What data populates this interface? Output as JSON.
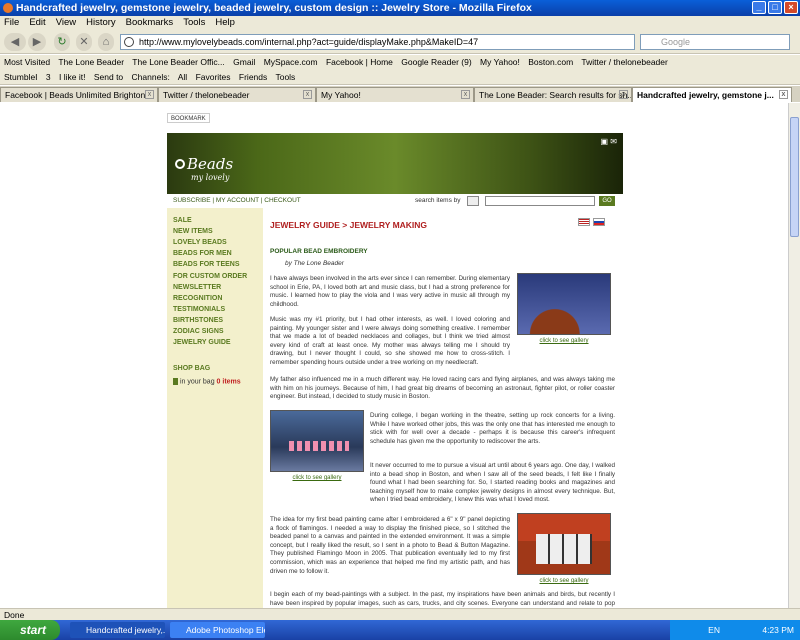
{
  "window": {
    "title": "Handcrafted jewelry, gemstone jewelry, beaded jewelry, custom design :: Jewelry Store - Mozilla Firefox"
  },
  "menu": [
    "File",
    "Edit",
    "View",
    "History",
    "Bookmarks",
    "Tools",
    "Help"
  ],
  "nav": {
    "url": "http://www.mylovelybeads.com/internal.php?act=guide/displayMake.php&MakeID=47",
    "search_placeholder": "Google"
  },
  "bookmarks": [
    "Most Visited",
    "The Lone Beader",
    "The Lone Beader Offic...",
    "Gmail",
    "MySpace.com",
    "Facebook | Home",
    "Google Reader (9)",
    "My Yahoo!",
    "Boston.com",
    "Twitter / thelonebeader"
  ],
  "toolbar2": [
    "StumbleI",
    "3",
    "I like it!",
    "Send to",
    "Channels:",
    "All",
    "Favorites",
    "Friends",
    "Tools"
  ],
  "tabs": [
    "Facebook | Beads Unlimited Brighton",
    "Twitter / thelonebeader",
    "My Yahoo!",
    "The Lone Beader: Search results for sh...",
    "Handcrafted jewelry, gemstone j..."
  ],
  "site": {
    "bookmark_btn": "BOOKMARK",
    "logo": "Beads",
    "logo_sub": "my lovely",
    "topnav": "SUBSCRIBE | MY ACCOUNT | CHECKOUT",
    "search_label": "search items by",
    "go": "GO",
    "sidebar": [
      "SALE",
      "NEW ITEMS",
      "LOVELY BEADS",
      "BEADS FOR MEN",
      "BEADS FOR TEENS",
      "FOR CUSTOM ORDER",
      "NEWSLETTER",
      "RECOGNITION",
      "TESTIMONIALS",
      "BIRTHSTONES",
      "ZODIAC SIGNS",
      "JEWELRY GUIDE"
    ],
    "shop_bag": "SHOP BAG",
    "in_bag": "in your bag",
    "in_bag_count": "0 items",
    "heading": "JEWELRY GUIDE > JEWELRY MAKING",
    "subhead": "POPULAR BEAD EMBROIDERY",
    "byline": "by The Lone Beader",
    "gallery_link": "click to see gallery",
    "p1": "I have always been involved in the arts ever since I can remember. During elementary school in Erie, PA, I loved both art and music class, but I had a strong preference for music. I learned how to play the viola and I was very active in music all through my childhood.",
    "p2": "Music was my #1 priority, but I had other interests, as well. I loved coloring and painting. My younger sister and I were always doing something creative. I remember that we made a lot of beaded necklaces and collages, but I think we tried almost every kind of craft at least once. My mother was always telling me I should try drawing, but I never thought I could, so she showed me how to cross-stitch. I remember spending hours outside under a tree working on my needlecraft.",
    "p3": "My father also influenced me in a much different way. He loved racing cars and flying airplanes, and was always taking me with him on his journeys. Because of him, I had great big dreams of becoming an astronaut, fighter pilot, or roller coaster engineer. But instead, I decided to study music in Boston.",
    "p4": "During college, I began working in the theatre, setting up rock concerts for a living. While I have worked other jobs, this was the only one that has interested me enough to stick with for well over a decade - perhaps it is because this career's infrequent schedule has given me the opportunity to rediscover the arts.",
    "p5": "It never occurred to me to pursue a visual art until about 6 years ago. One day, I walked into a bead shop in Boston, and when I saw all of the seed beads, I felt like I finally found what I had been searching for. So, I started reading books and magazines and teaching myself how to make complex jewelry designs in almost every technique. But, when I tried bead embroidery, I knew this was what I loved most.",
    "p6": "The idea for my first bead painting came after I embroidered a 6\" x 9\" panel depicting a flock of flamingos. I needed a way to display the finished piece, so I stitched the beaded panel to a canvas and painted in the extended environment. It was a simple concept, but I really liked the result, so I sent in a photo to Bead & Button Magazine. They published Flamingo Moon in 2005. That publication eventually led to my first commission, which was an experience that helped me find my artistic path, and has driven me to follow it.",
    "p7": "I begin each of my bead-paintings with a subject. In the past, my inspirations have been animals and birds, but recently I have been inspired by popular images, such as cars, trucks, and city scenes. Everyone can understand and relate to pop art images in one way or another. What people may not understand is why I recreate these images in beads, but the beads themselves"
  },
  "status": "Done",
  "taskbar": {
    "start": "start",
    "tasks": [
      "Handcrafted jewelry,...",
      "Adobe Photoshop Ele..."
    ],
    "lang": "EN",
    "time": "4:23 PM"
  }
}
